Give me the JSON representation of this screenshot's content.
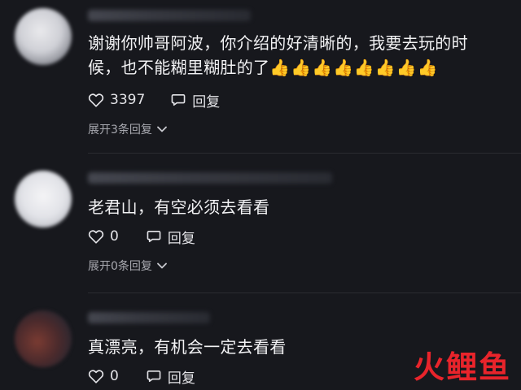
{
  "comments": [
    {
      "text_line1": "谢谢你帅哥阿波，你介绍的好清晰的，我要去玩的时",
      "text_line2": "候，也不能糊里糊肚的了",
      "emoji": "👍👍👍👍👍👍👍👍",
      "likes": "3397",
      "reply_label": "回复",
      "expand_label": "展开3条回复"
    },
    {
      "text_line1": "老君山，有空必须去看看",
      "likes": "0",
      "reply_label": "回复",
      "expand_label": "展开0条回复"
    },
    {
      "text_line1": "真漂亮，有机会一定去看看",
      "likes": "0",
      "reply_label": "回复"
    }
  ],
  "watermark": {
    "char1": "火",
    "char2": "鲤",
    "char3": "鱼"
  },
  "colors": {
    "background": "#17181d",
    "text": "#f2f2f4",
    "secondary_text": "#a8a9b0",
    "watermark": "#e8242b"
  },
  "icons": {
    "like": "heart-outline-icon",
    "reply": "speech-bubble-icon",
    "expand": "chevron-down-icon"
  }
}
